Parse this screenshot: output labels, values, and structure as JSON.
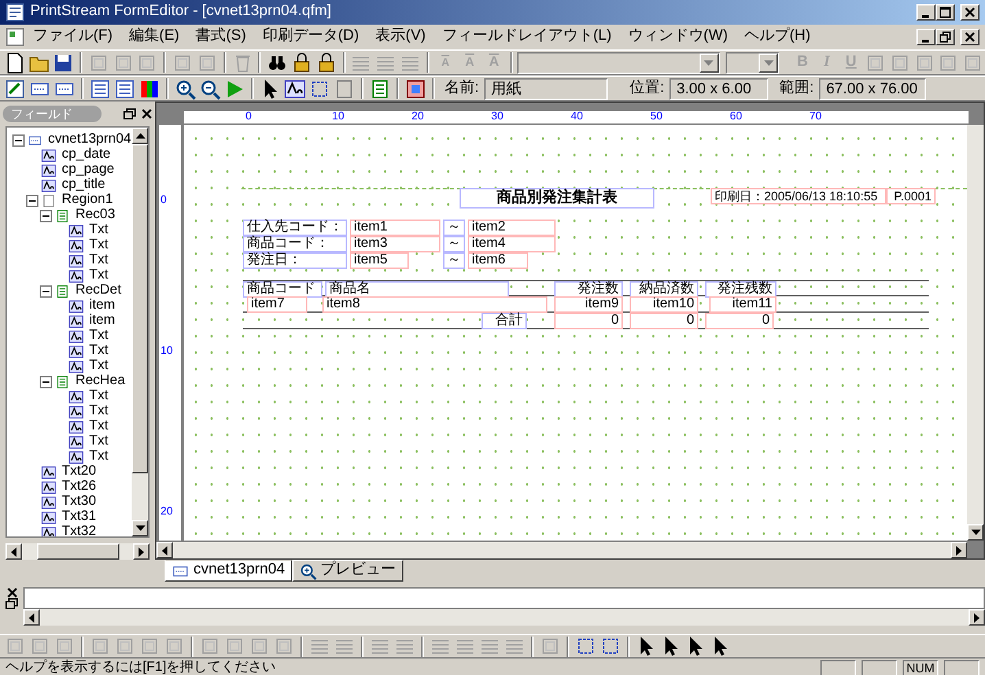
{
  "window": {
    "title": "PrintStream FormEditor - [cvnet13prn04.qfm]"
  },
  "menu": [
    "ファイル(F)",
    "編集(E)",
    "書式(S)",
    "印刷データ(D)",
    "表示(V)",
    "フィールドレイアウト(L)",
    "ウィンドウ(W)",
    "ヘルプ(H)"
  ],
  "format_toolbar": {
    "font_buttons": [
      {
        "label": "A",
        "disabled": true
      },
      {
        "label": "A",
        "disabled": true
      },
      {
        "label": "A",
        "disabled": true
      }
    ],
    "style_buttons": [
      {
        "label": "B",
        "disabled": true
      },
      {
        "label": "I",
        "disabled": true
      },
      {
        "label": "U",
        "disabled": true
      }
    ]
  },
  "property_bar": {
    "name_label": "名前:",
    "name": "用紙",
    "position_label": "位置:",
    "position": "3.00 x 6.00",
    "range_label": "範囲:",
    "range": "67.00 x 76.00"
  },
  "field_panel": {
    "title": "フィールド",
    "tree": [
      {
        "label": "cvnet13prn04",
        "kind": "form",
        "expanded": true,
        "children": [
          {
            "label": "cp_date",
            "kind": "text"
          },
          {
            "label": "cp_page",
            "kind": "text"
          },
          {
            "label": "cp_title",
            "kind": "text"
          },
          {
            "label": "Region1",
            "kind": "region",
            "expanded": true,
            "children": [
              {
                "label": "Rec03",
                "kind": "record",
                "expanded": true,
                "children": [
                  {
                    "label": "Txt",
                    "kind": "text"
                  },
                  {
                    "label": "Txt",
                    "kind": "text"
                  },
                  {
                    "label": "Txt",
                    "kind": "text"
                  },
                  {
                    "label": "Txt",
                    "kind": "text"
                  }
                ]
              },
              {
                "label": "RecDet",
                "kind": "record",
                "expanded": true,
                "children": [
                  {
                    "label": "item",
                    "kind": "text"
                  },
                  {
                    "label": "item",
                    "kind": "text"
                  },
                  {
                    "label": "Txt",
                    "kind": "text"
                  },
                  {
                    "label": "Txt",
                    "kind": "text"
                  },
                  {
                    "label": "Txt",
                    "kind": "text"
                  }
                ]
              },
              {
                "label": "RecHea",
                "kind": "record",
                "expanded": true,
                "children": [
                  {
                    "label": "Txt",
                    "kind": "text"
                  },
                  {
                    "label": "Txt",
                    "kind": "text"
                  },
                  {
                    "label": "Txt",
                    "kind": "text"
                  },
                  {
                    "label": "Txt",
                    "kind": "text"
                  },
                  {
                    "label": "Txt",
                    "kind": "text"
                  }
                ]
              }
            ]
          },
          {
            "label": "Txt20",
            "kind": "text"
          },
          {
            "label": "Txt26",
            "kind": "text"
          },
          {
            "label": "Txt30",
            "kind": "text"
          },
          {
            "label": "Txt31",
            "kind": "text"
          },
          {
            "label": "Txt32",
            "kind": "text"
          }
        ]
      }
    ]
  },
  "rulers": {
    "horizontal": [
      "0",
      "10",
      "20",
      "30",
      "40",
      "50",
      "60",
      "70"
    ],
    "vertical": [
      "0",
      "10",
      "20"
    ]
  },
  "form": {
    "title": "商品別発注集計表",
    "print_date": "印刷日：2005/06/13 18:10:55",
    "page": "P.0001",
    "criteria": [
      {
        "label": "仕入先コード：",
        "from": "item1",
        "separator": "～",
        "to": "item2"
      },
      {
        "label": "商品コード：",
        "from": "item3",
        "separator": "～",
        "to": "item4"
      },
      {
        "label": "発注日：",
        "from": "item5",
        "separator": "～",
        "to": "item6"
      }
    ],
    "columns": [
      "商品コード",
      "商品名",
      "発注数",
      "納品済数",
      "発注残数"
    ],
    "detail": [
      "item7",
      "item8",
      "item9",
      "item10",
      "item11"
    ],
    "total_label": "合計",
    "totals": [
      "0",
      "0",
      "0"
    ]
  },
  "doc_tabs": [
    {
      "label": "cvnet13prn04",
      "selected": true
    },
    {
      "label": "プレビュー",
      "selected": false
    }
  ],
  "status_bar": {
    "message": "ヘルプを表示するには[F1]を押してください",
    "indicators": [
      "NUM"
    ]
  }
}
